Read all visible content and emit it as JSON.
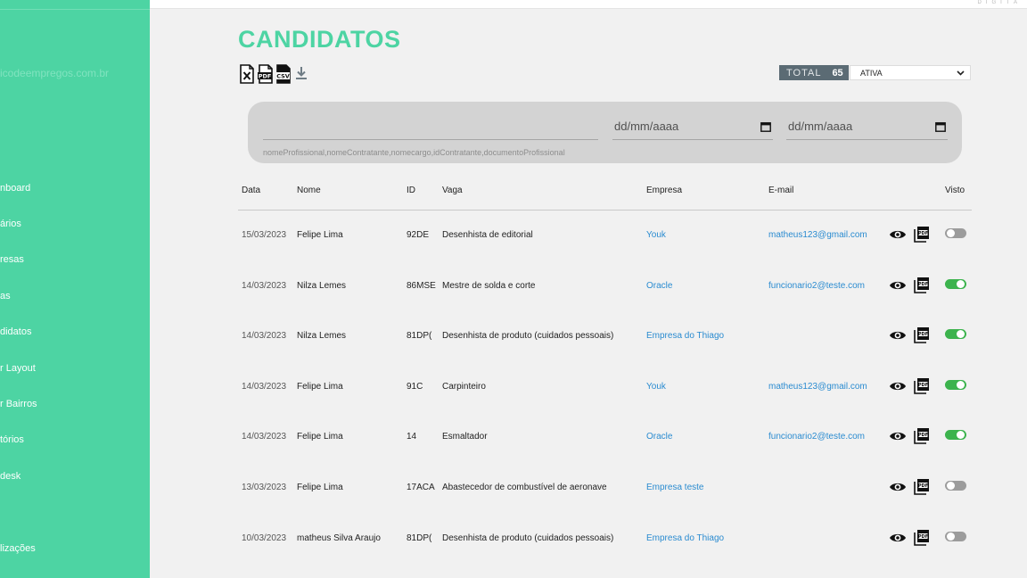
{
  "brand": "DIGITA",
  "sidebar": {
    "site": "icodeempregos.com.br",
    "items": [
      {
        "label": "nboard"
      },
      {
        "label": "ários"
      },
      {
        "label": "resas"
      },
      {
        "label": "as"
      },
      {
        "label": "didatos"
      },
      {
        "label": "r Layout"
      },
      {
        "label": "r Bairros"
      },
      {
        "label": "tórios"
      },
      {
        "label": "desk"
      },
      {
        "label": "lizações"
      }
    ]
  },
  "page": {
    "title": "CANDIDATOS"
  },
  "export_icons": [
    "excel-icon",
    "pdf-icon",
    "csv-icon",
    "download-icon"
  ],
  "total": {
    "label": "TOTAL",
    "value": "65"
  },
  "status_select": {
    "value": "ATIVA"
  },
  "filter": {
    "search_hint": "nomeProfissional,nomeContratante,nomecargo,idContratante,documentoProfissional",
    "date_from_placeholder": "dd/mm/aaaa",
    "date_to_placeholder": "dd/mm/aaaa"
  },
  "table": {
    "headers": [
      "Data",
      "Nome",
      "ID",
      "Vaga",
      "Empresa",
      "E-mail",
      "Visto"
    ],
    "rows": [
      {
        "date": "15/03/2023",
        "name": "Felipe Lima",
        "id": "92DE",
        "job": "Desenhista de editorial",
        "company": "Youk",
        "email": "matheus123@gmail.com",
        "seen": false
      },
      {
        "date": "14/03/2023",
        "name": "Nilza Lemes",
        "id": "86MSE",
        "job": "Mestre de solda e corte",
        "company": "Oracle",
        "email": "funcionario2@teste.com",
        "seen": true
      },
      {
        "date": "14/03/2023",
        "name": "Nilza Lemes",
        "id": "81DP(",
        "job": "Desenhista de produto (cuidados pessoais)",
        "company": "Empresa do Thiago",
        "email": "",
        "seen": true
      },
      {
        "date": "14/03/2023",
        "name": "Felipe Lima",
        "id": "91C",
        "job": "Carpinteiro",
        "company": "Youk",
        "email": "matheus123@gmail.com",
        "seen": true
      },
      {
        "date": "14/03/2023",
        "name": "Felipe Lima",
        "id": "14",
        "job": "Esmaltador",
        "company": "Oracle",
        "email": "funcionario2@teste.com",
        "seen": true
      },
      {
        "date": "13/03/2023",
        "name": "Felipe Lima",
        "id": "17ACA",
        "job": "Abastecedor de combustível de aeronave",
        "company": "Empresa teste",
        "email": "",
        "seen": false
      },
      {
        "date": "10/03/2023",
        "name": "matheus Silva Araujo",
        "id": "81DP(",
        "job": "Desenhista de produto (cuidados pessoais)",
        "company": "Empresa do Thiago",
        "email": "",
        "seen": false
      }
    ]
  },
  "colors": {
    "accent": "#4dd4a3",
    "link": "#2a8bd0",
    "toggle_on": "#3cb34d",
    "toggle_off": "#9c9c9c",
    "total_bg": "#5b6b74"
  }
}
